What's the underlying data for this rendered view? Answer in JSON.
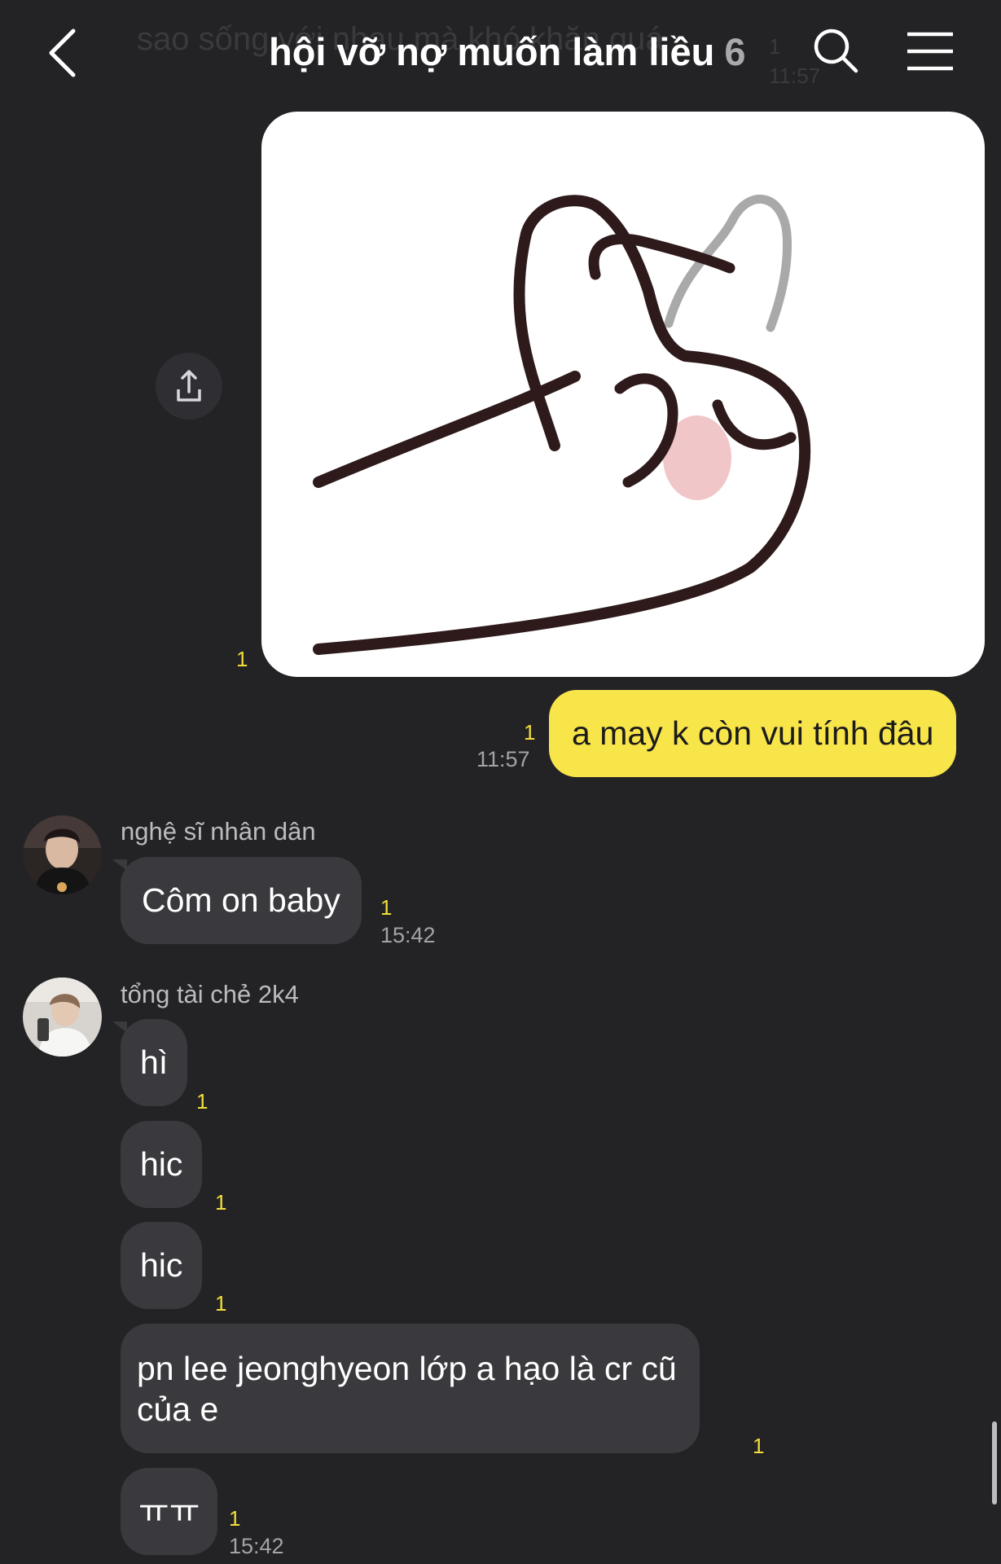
{
  "header": {
    "back_icon": "chevron-left-icon",
    "title": "hội vỡ nợ muốn làm liều",
    "member_count": "6",
    "search_icon": "search-icon",
    "menu_icon": "hamburger-menu-icon",
    "behind_text": "sao sống với nhau mà khó khăn quá",
    "behind_unread": "1",
    "behind_time": "11:57"
  },
  "messages": {
    "image_message": {
      "unread": "1",
      "share_icon": "share-icon"
    },
    "mine_text": {
      "text": "a may k còn vui tính đâu",
      "unread": "1",
      "time": "11:57"
    },
    "group1": {
      "sender": "nghệ sĩ nhân dân",
      "text": "Côm on baby",
      "unread": "1",
      "time": "15:42"
    },
    "group2": {
      "sender": "tổng tài chẻ 2k4",
      "items": [
        {
          "text": "hì",
          "unread": "1"
        },
        {
          "text": "hic",
          "unread": "1"
        },
        {
          "text": "hic",
          "unread": "1"
        },
        {
          "text_line1": "pn lee jeonghyeon lớp a hạo là cr cũ",
          "text_line2": "của e",
          "unread": "1"
        },
        {
          "text": "ㅠㅠ",
          "unread": "1",
          "time": "15:42"
        }
      ]
    }
  },
  "colors": {
    "background": "#232326",
    "bubble_mine": "#f8e54a",
    "bubble_other": "#3a3a3e",
    "unread": "#f2dd3a"
  }
}
